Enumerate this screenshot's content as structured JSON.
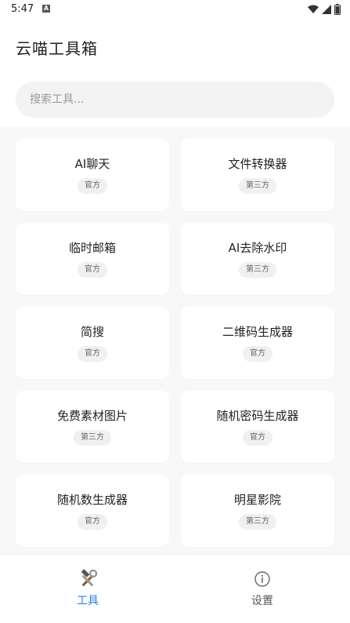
{
  "status_bar": {
    "time": "5:47",
    "notification_icon": "a-notification-icon",
    "wifi_icon": "wifi-icon",
    "signal_icon": "signal-icon",
    "battery_icon": "battery-icon"
  },
  "header": {
    "title": "云喵工具箱"
  },
  "search": {
    "placeholder": "搜索工具..."
  },
  "tools": [
    {
      "name": "AI聊天",
      "badge": "官方"
    },
    {
      "name": "文件转换器",
      "badge": "第三方"
    },
    {
      "name": "临时邮箱",
      "badge": "官方"
    },
    {
      "name": "AI去除水印",
      "badge": "第三方"
    },
    {
      "name": "简搜",
      "badge": "官方"
    },
    {
      "name": "二维码生成器",
      "badge": "官方"
    },
    {
      "name": "免费素材图片",
      "badge": "第三方"
    },
    {
      "name": "随机密码生成器",
      "badge": "官方"
    },
    {
      "name": "随机数生成器",
      "badge": "官方"
    },
    {
      "name": "明星影院",
      "badge": "第三方"
    }
  ],
  "bottom_nav": {
    "tools_label": "工具",
    "tools_icon": "hammer-wrench-icon",
    "settings_label": "设置",
    "settings_icon": "info-icon",
    "active": "tools",
    "active_color": "#2b7de9"
  }
}
